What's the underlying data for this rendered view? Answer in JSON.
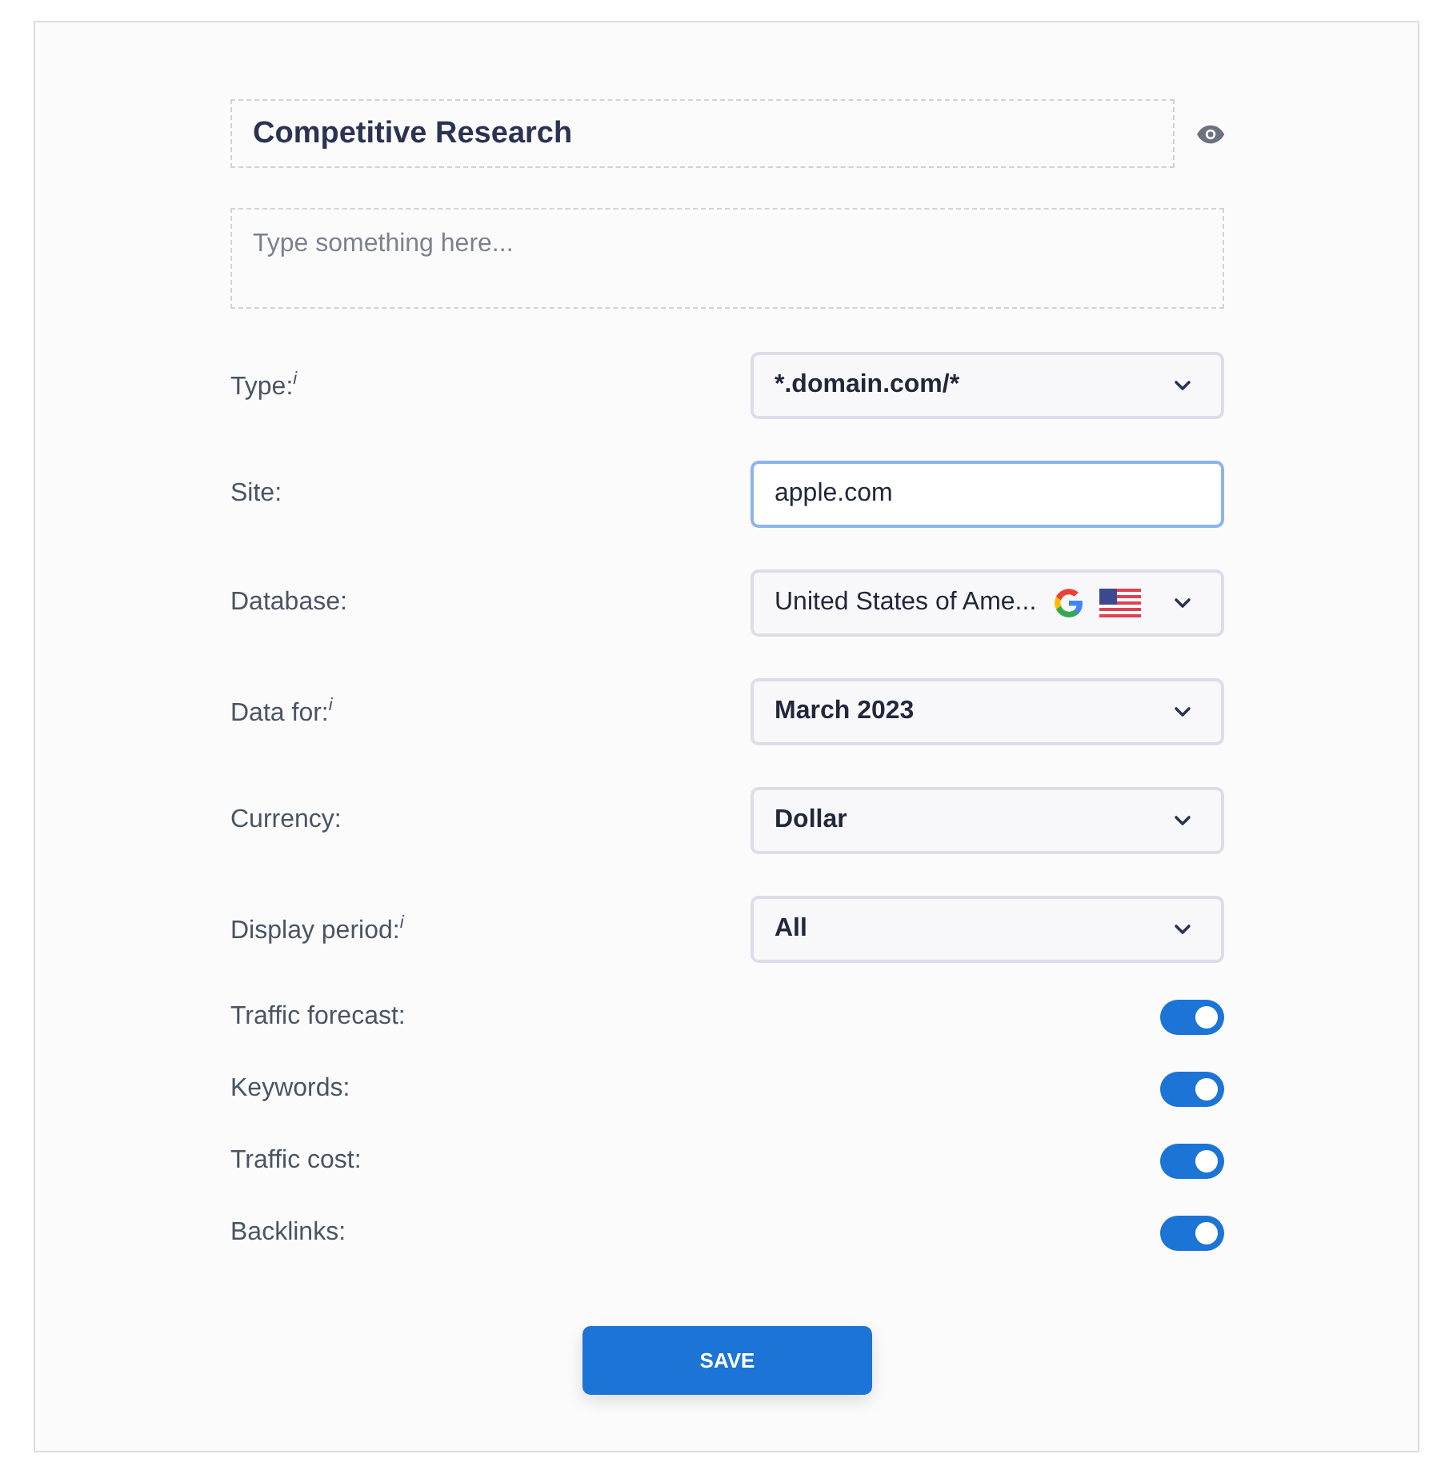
{
  "title_field": {
    "value": "Competitive Research"
  },
  "description_field": {
    "placeholder": "Type something here..."
  },
  "fields": [
    {
      "kind": "select",
      "label": "Type:$^{i}$",
      "value": "*.domain.com/*"
    },
    {
      "kind": "input",
      "label": "Site:",
      "value": "apple.com",
      "focused": true
    },
    {
      "kind": "database",
      "label": "Database:",
      "value": "United States of Ame..."
    },
    {
      "kind": "select",
      "label": "Data for:$^{i}$",
      "value": "March 2023"
    },
    {
      "kind": "select",
      "label": "Currency:",
      "value": "Dollar"
    },
    {
      "kind": "select",
      "label": "Display period:$^{i}$",
      "value": "All"
    }
  ],
  "toggles": [
    {
      "label": "Traffic forecast:",
      "on": true
    },
    {
      "label": "Keywords:",
      "on": true
    },
    {
      "label": "Traffic cost:",
      "on": true
    },
    {
      "label": "Backlinks:",
      "on": true
    }
  ],
  "save_button": "SAVE"
}
